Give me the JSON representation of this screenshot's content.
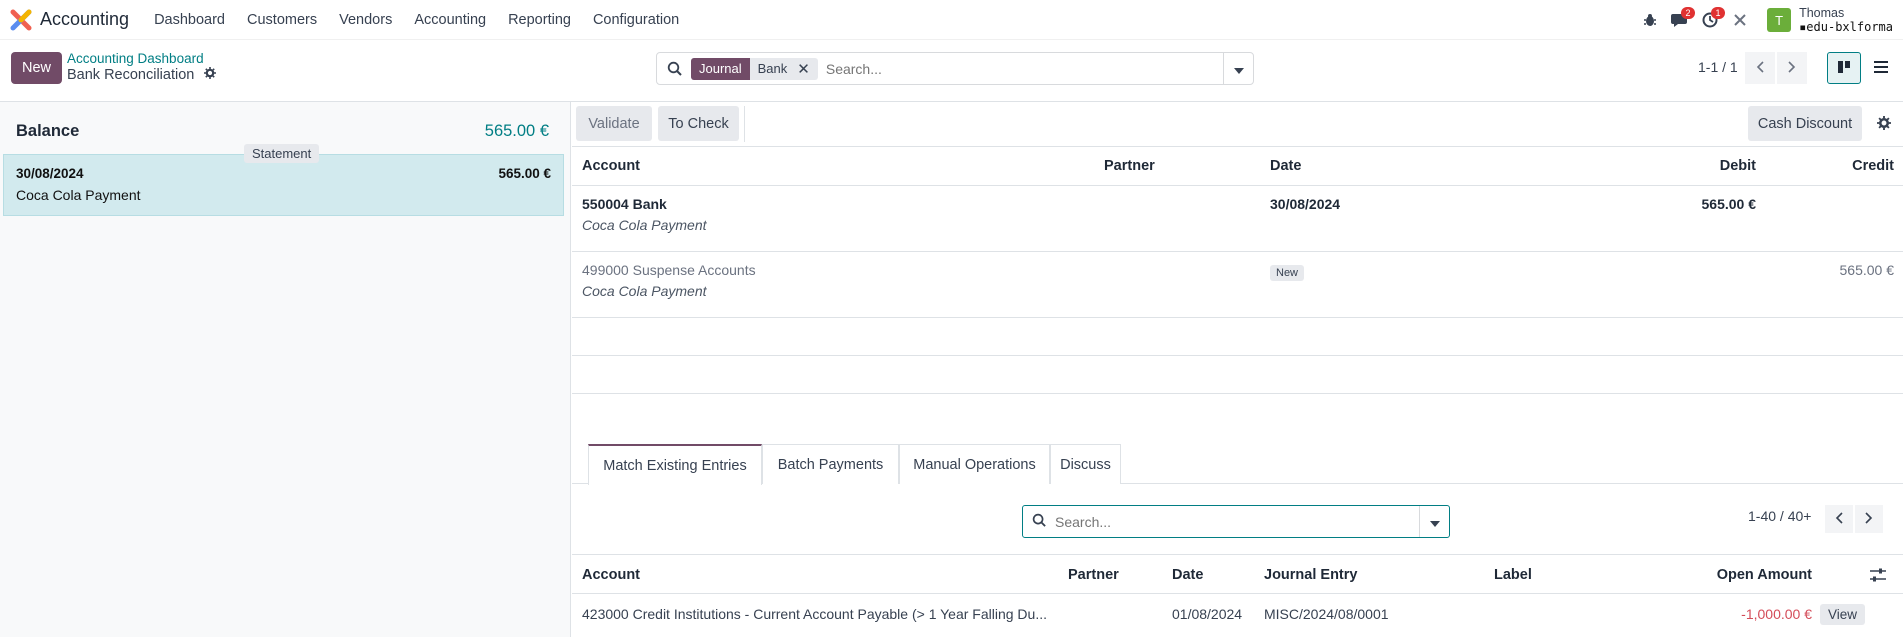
{
  "navbar": {
    "app_title": "Accounting",
    "menu": [
      "Dashboard",
      "Customers",
      "Vendors",
      "Accounting",
      "Reporting",
      "Configuration"
    ],
    "messages_count": "2",
    "activities_count": "1",
    "user_initial": "T",
    "user_name": "Thomas",
    "database": "edu-bxlforma"
  },
  "control_panel": {
    "new_label": "New",
    "breadcrumb_parent": "Accounting Dashboard",
    "breadcrumb_current": "Bank Reconciliation",
    "search": {
      "facet_label": "Journal",
      "facet_value": "Bank",
      "placeholder": "Search..."
    },
    "pager": "1-1 / 1"
  },
  "left_panel": {
    "balance_label": "Balance",
    "balance_amount": "565.00 €",
    "statement_badge": "Statement",
    "statement_line": {
      "date": "30/08/2024",
      "amount": "565.00 €",
      "label": "Coca Cola Payment"
    }
  },
  "actions": {
    "validate": "Validate",
    "to_check": "To Check",
    "cash_discount": "Cash Discount"
  },
  "lines_table": {
    "headers": {
      "account": "Account",
      "partner": "Partner",
      "date": "Date",
      "debit": "Debit",
      "credit": "Credit"
    },
    "rows": [
      {
        "account": "550004 Bank",
        "label": "Coca Cola Payment",
        "date": "30/08/2024",
        "debit": "565.00 €",
        "credit": ""
      },
      {
        "account": "499000 Suspense Accounts",
        "label": "Coca Cola Payment",
        "badge": "New",
        "debit": "",
        "credit": "565.00 €"
      }
    ]
  },
  "tabs": [
    "Match Existing Entries",
    "Batch Payments",
    "Manual Operations",
    "Discuss"
  ],
  "match": {
    "search_placeholder": "Search...",
    "pager": "1-40 / 40+",
    "headers": {
      "account": "Account",
      "partner": "Partner",
      "date": "Date",
      "journal_entry": "Journal Entry",
      "label": "Label",
      "open_amount": "Open Amount"
    },
    "rows": [
      {
        "account": "423000 Credit Institutions - Current Account Payable (> 1 Year Falling Du...",
        "partner": "",
        "date": "01/08/2024",
        "journal_entry": "MISC/2024/08/0001",
        "label": "",
        "open_amount": "-1,000.00 €",
        "action": "View"
      }
    ]
  }
}
